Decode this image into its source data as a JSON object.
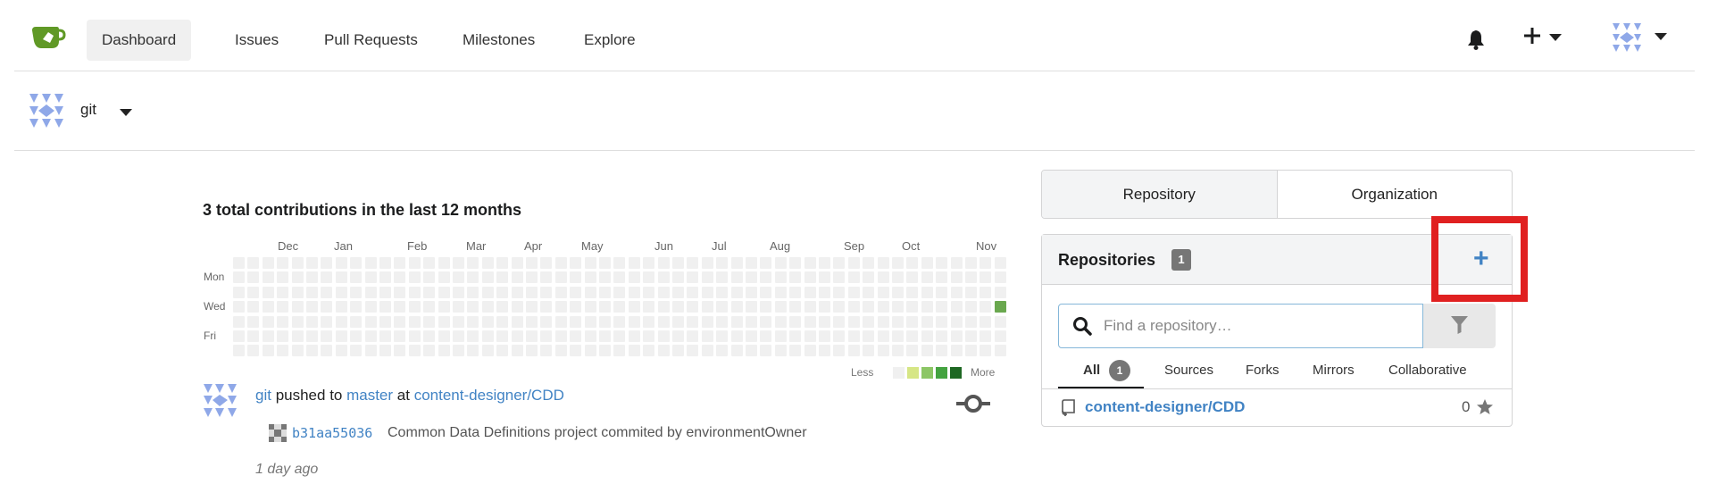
{
  "nav": {
    "items": [
      {
        "label": "Dashboard",
        "active": true
      },
      {
        "label": "Issues"
      },
      {
        "label": "Pull Requests"
      },
      {
        "label": "Milestones"
      },
      {
        "label": "Explore"
      }
    ],
    "icons": [
      "bell-icon",
      "plus-icon",
      "user-avatar"
    ]
  },
  "context": {
    "user": "git"
  },
  "heatmap": {
    "title": "3 total contributions in the last 12 months",
    "months": [
      "Dec",
      "Jan",
      "Feb",
      "Mar",
      "Apr",
      "May",
      "Jun",
      "Jul",
      "Aug",
      "Sep",
      "Oct",
      "Nov"
    ],
    "days": [
      "Mon",
      "Wed",
      "Fri"
    ],
    "legend_less": "Less",
    "legend_more": "More",
    "colors": [
      "#f0f0f0",
      "#d6e685",
      "#8cc665",
      "#44a340",
      "#1e6823"
    ],
    "active_color": "#6aa84f"
  },
  "feed": {
    "actor": "git",
    "verb": " pushed to ",
    "branch": "master",
    "at": " at ",
    "repo": "content-designer/CDD",
    "sha": "b31aa55036",
    "message": "Common Data Definitions project commited by environmentOwner",
    "time": "1 day ago"
  },
  "panel": {
    "tabs": [
      {
        "label": "Repository",
        "active": true
      },
      {
        "label": "Organization"
      }
    ],
    "repos_title": "Repositories",
    "repos_count": "1",
    "add_label": "+",
    "search_placeholder": "Find a repository…",
    "filters": [
      {
        "label": "All",
        "active": true
      },
      {
        "label": "Sources"
      },
      {
        "label": "Forks"
      },
      {
        "label": "Mirrors"
      },
      {
        "label": "Collaborative"
      }
    ],
    "all_count": "1",
    "repo_list": [
      {
        "name": "content-designer/CDD",
        "stars": "0"
      }
    ]
  },
  "accent_color": "#4183c4",
  "highlight_color": "#e02020"
}
